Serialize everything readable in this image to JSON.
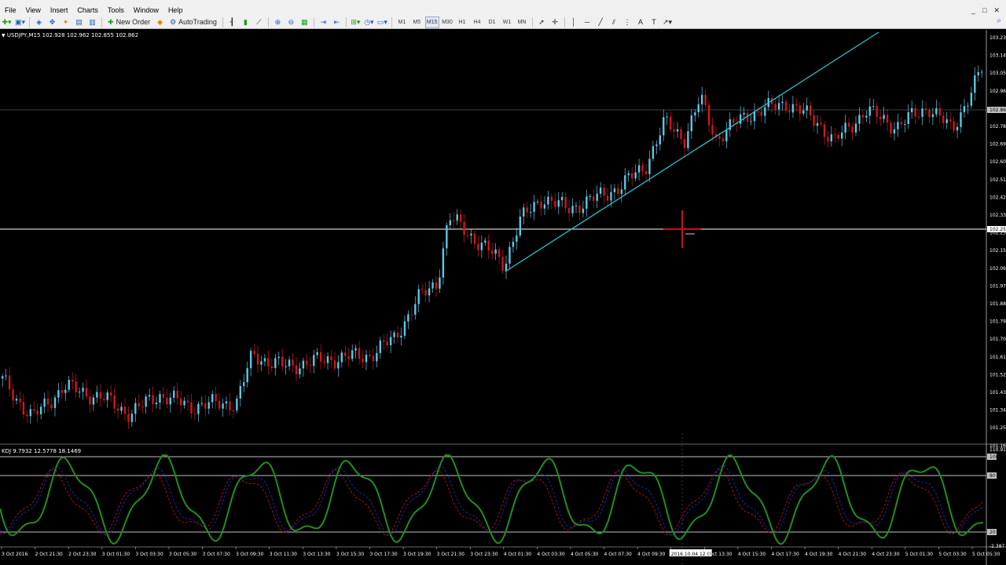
{
  "menu": [
    "File",
    "View",
    "Insert",
    "Charts",
    "Tools",
    "Window",
    "Help"
  ],
  "window_controls": [
    "_",
    "□",
    "✕"
  ],
  "toolbar": {
    "new_order_label": "New Order",
    "autotrading_label": "AutoTrading",
    "timeframes": [
      "M1",
      "M5",
      "M15",
      "M30",
      "H1",
      "H4",
      "D1",
      "W1",
      "MN"
    ],
    "active_timeframe": "M15"
  },
  "chart": {
    "header": "USDJPY,M15  102.928 102.962 102.855 102.862",
    "price_labels": [
      "103.230",
      "103.140",
      "103.050",
      "102.960",
      "102.862",
      "102.780",
      "102.690",
      "102.600",
      "102.510",
      "102.420",
      "102.330",
      "102.250",
      "102.150",
      "102.060",
      "101.970",
      "101.880",
      "101.790",
      "101.700",
      "101.610",
      "101.520",
      "101.430",
      "101.340",
      "101.250",
      "101.160"
    ],
    "current_price_label": "102.862",
    "crosshair_price_label": "102.250",
    "colors": {
      "bull": "#5bc8e8",
      "bear": "#d01818",
      "trendline": "#27c3cc",
      "grid_line": "#ffffff",
      "cursor": "#c8101a"
    }
  },
  "indicator": {
    "header": "KDJ 9.7932 12.5778 18.1469",
    "top_value": "110.917",
    "levels": [
      "100",
      "80",
      "20"
    ],
    "bottom_value": "-2.387",
    "colors": {
      "k": "#1f8f1f",
      "d": "#c01818",
      "j": "#2030c8"
    }
  },
  "time_labels": [
    "3 Oct 2016",
    "2 Oct 21:30",
    "2 Oct 23:30",
    "3 Oct 01:30",
    "3 Oct 03:30",
    "3 Oct 05:30",
    "3 Oct 07:30",
    "3 Oct 09:30",
    "3 Oct 11:30",
    "3 Oct 13:30",
    "3 Oct 15:30",
    "3 Oct 17:30",
    "3 Oct 19:30",
    "3 Oct 21:30",
    "3 Oct 23:30",
    "4 Oct 01:30",
    "4 Oct 03:30",
    "4 Oct 05:30",
    "4 Oct 07:30",
    "4 Oct 09:30",
    "2016.10.04 12:00",
    "4 Oct 13:30",
    "4 Oct 15:30",
    "4 Oct 17:30",
    "4 Oct 19:30",
    "4 Oct 21:30",
    "4 Oct 23:30",
    "5 Oct 01:30",
    "5 Oct 03:30",
    "5 Oct 05:30"
  ]
}
